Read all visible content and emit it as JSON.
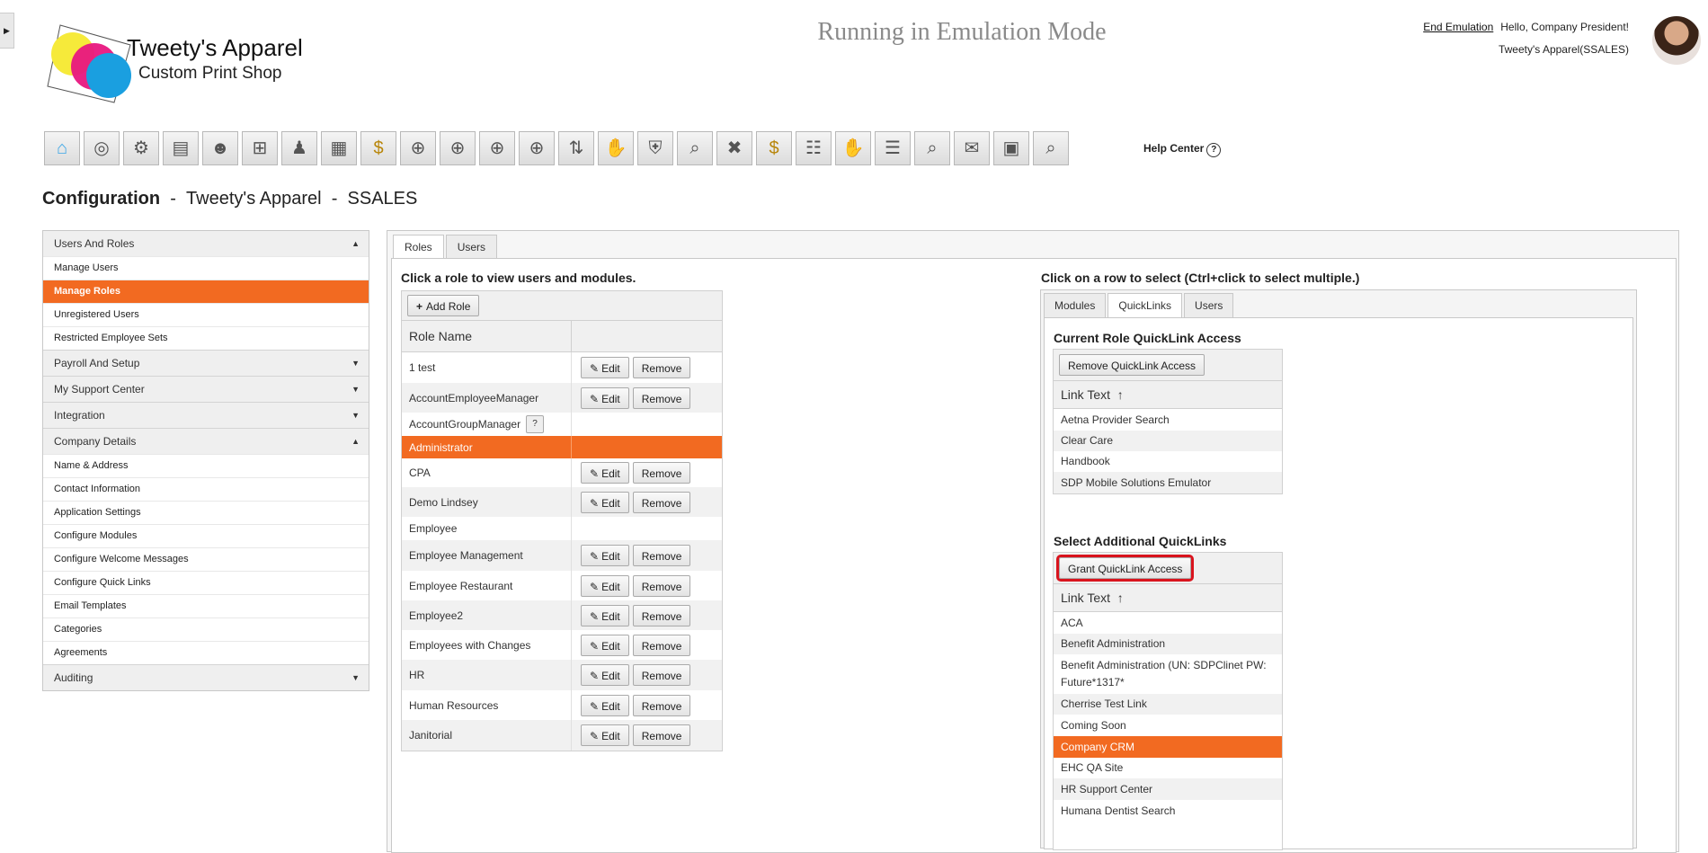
{
  "brand": {
    "name": "Tweety's Apparel",
    "tagline": "Custom Print Shop"
  },
  "header": {
    "emulation": "Running in Emulation Mode",
    "end_emulation": "End Emulation",
    "greeting": "Hello, Company President!",
    "company": "Tweety's Apparel(SSALES)"
  },
  "toolbar": {
    "icons": [
      "home-icon",
      "benefits-icon",
      "people-settings-icon",
      "presentation-icon",
      "team-icon",
      "org-chart-icon",
      "hierarchy-icon",
      "document-icon",
      "money-bag-icon",
      "target-icon",
      "target-icon",
      "target-icon",
      "target-icon",
      "transfer-icon",
      "handshake-icon",
      "shield-icon",
      "search-person-icon",
      "remove-person-icon",
      "money-bag-icon",
      "group-chart-icon",
      "handshake-icon",
      "group-icon",
      "search-person-icon",
      "gift-icon",
      "board-icon",
      "search-money-icon"
    ],
    "help": "Help Center",
    "help_q": "?"
  },
  "page": {
    "title_bold": "Configuration",
    "sep1": "-",
    "company": "Tweety's Apparel",
    "sep2": "-",
    "code": "SSALES"
  },
  "nav": {
    "users_roles": {
      "label": "Users And Roles",
      "arrow": "▲"
    },
    "users_items": [
      "Manage Users",
      "Manage Roles",
      "Unregistered Users",
      "Restricted Employee Sets"
    ],
    "payroll": {
      "label": "Payroll And Setup",
      "arrow": "▼"
    },
    "support": {
      "label": "My Support Center",
      "arrow": "▼"
    },
    "integration": {
      "label": "Integration",
      "arrow": "▼"
    },
    "company_details": {
      "label": "Company Details",
      "arrow": "▲"
    },
    "company_items": [
      "Name & Address",
      "Contact Information",
      "Application Settings",
      "Configure Modules",
      "Configure Welcome Messages",
      "Configure Quick Links",
      "Email Templates",
      "Categories",
      "Agreements"
    ],
    "auditing": {
      "label": "Auditing",
      "arrow": "▼"
    }
  },
  "main": {
    "tabs": [
      "Roles",
      "Users"
    ],
    "left_heading": "Click a role to view users and modules.",
    "add_role": "Add Role",
    "add_icon": "+",
    "col_role": "Role Name",
    "edit": "Edit",
    "remove": "Remove",
    "help_q": "?",
    "roles": [
      "1 test",
      "AccountEmployeeManager",
      "AccountGroupManager",
      "Administrator",
      "CPA",
      "Demo Lindsey",
      "Employee",
      "Employee Management",
      "Employee Restaurant",
      "Employee2",
      "Employees with Changes",
      "HR",
      "Human Resources",
      "Janitorial"
    ],
    "right_heading": "Click on a row to select (Ctrl+click to select multiple.)",
    "rtabs": [
      "Modules",
      "QuickLinks",
      "Users"
    ],
    "current_title": "Current Role QuickLink Access",
    "remove_access": "Remove QuickLink Access",
    "link_text": "Link Text",
    "sort_arrow": "↑",
    "current_links": [
      "Aetna Provider Search",
      "Clear Care",
      "Handbook",
      "SDP Mobile Solutions Emulator"
    ],
    "additional_title": "Select Additional QuickLinks",
    "grant_access": "Grant QuickLink Access",
    "additional_links": [
      "ACA",
      "Benefit Administration",
      "Benefit Administration (UN: SDPClinet PW: Future*1317*",
      "Cherrise Test Link",
      "Coming Soon",
      "Company CRM",
      "EHC QA Site",
      "HR Support Center",
      "Humana Dentist Search"
    ]
  }
}
